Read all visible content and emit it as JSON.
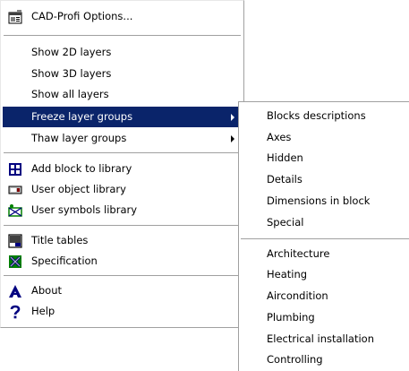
{
  "main_menu": {
    "items": [
      {
        "label": "CAD-Profi Options...",
        "icon": "options-dialog-icon"
      },
      {
        "label": "Show 2D layers"
      },
      {
        "label": "Show 3D layers"
      },
      {
        "label": "Show all layers"
      },
      {
        "label": "Freeze layer groups",
        "submenu": true,
        "highlighted": true
      },
      {
        "label": "Thaw layer groups",
        "submenu": true
      },
      {
        "label": "Add block to library",
        "icon": "block-library-icon"
      },
      {
        "label": "User object library",
        "icon": "object-library-icon"
      },
      {
        "label": "User symbols library",
        "icon": "symbols-library-icon"
      },
      {
        "label": "Title tables",
        "icon": "title-table-icon"
      },
      {
        "label": "Specification",
        "icon": "specification-icon"
      },
      {
        "label": "About",
        "icon": "about-icon"
      },
      {
        "label": "Help",
        "icon": "help-icon"
      }
    ]
  },
  "submenu": {
    "items": [
      {
        "label": "Blocks descriptions"
      },
      {
        "label": "Axes"
      },
      {
        "label": "Hidden"
      },
      {
        "label": "Details"
      },
      {
        "label": "Dimensions in block"
      },
      {
        "label": "Special"
      },
      {
        "label": "Architecture"
      },
      {
        "label": "Heating"
      },
      {
        "label": "Aircondition"
      },
      {
        "label": "Plumbing"
      },
      {
        "label": "Electrical installation"
      },
      {
        "label": "Controlling"
      }
    ]
  },
  "colors": {
    "highlight": "#0a246a",
    "highlight_text": "#ffffff",
    "menu_bg": "#ffffff"
  }
}
